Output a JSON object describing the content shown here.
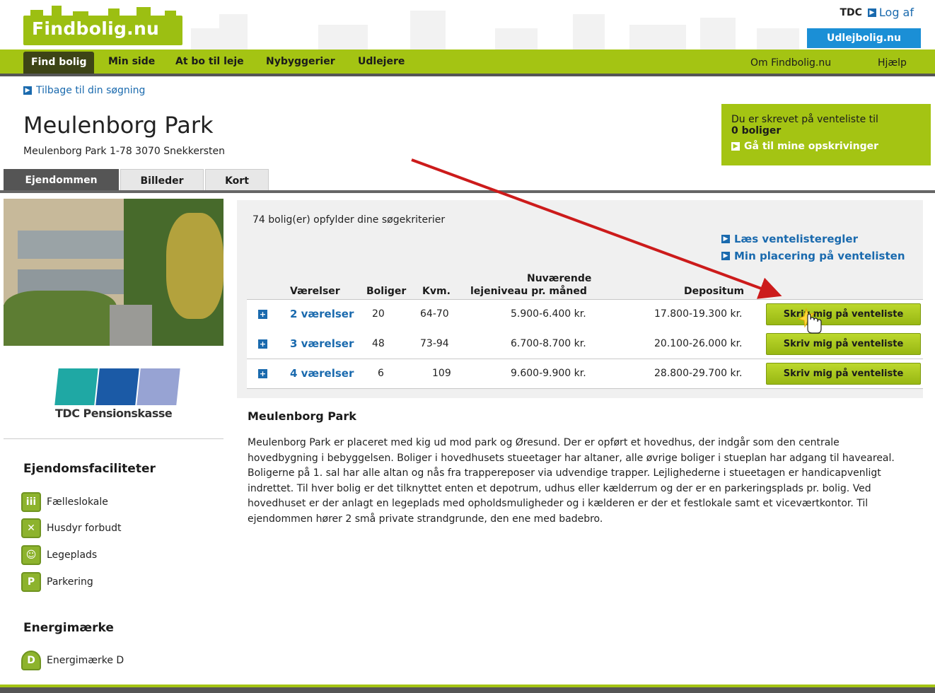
{
  "header": {
    "logo": "Findbolig.nu",
    "company": "TDC",
    "logout": "Log af",
    "partner": "Udlejbolig.nu"
  },
  "nav": {
    "items": [
      "Find bolig",
      "Min side",
      "At bo til leje",
      "Nybyggerier",
      "Udlejere"
    ],
    "right": [
      "Om Findbolig.nu",
      "Hjælp"
    ]
  },
  "back_link": "Tilbage til din søgning",
  "property": {
    "name": "Meulenborg Park",
    "address": "Meulenborg Park 1-78 3070 Snekkersten"
  },
  "waitlist": {
    "text": "Du er skrevet på venteliste til",
    "count": "0 boliger",
    "link": "Gå til mine opskrivinger"
  },
  "tabs": [
    "Ejendommen",
    "Billeder",
    "Kort"
  ],
  "sidebar": {
    "owner_logo": "TDC Pensionskasse",
    "facilities_title": "Ejendomsfaciliteter",
    "facilities": [
      {
        "label": "Fælleslokale",
        "icon": "people-icon"
      },
      {
        "label": "Husdyr forbudt",
        "icon": "no-pets-icon"
      },
      {
        "label": "Legeplads",
        "icon": "playground-icon"
      },
      {
        "label": "Parkering",
        "icon": "parking-icon"
      }
    ],
    "energy_title": "Energimærke",
    "energy_label": "Energimærke D",
    "energy_letter": "D"
  },
  "results": {
    "count_text": "74 bolig(er) opfylder dine søgekriterier",
    "links": [
      "Læs ventelisteregler",
      "Min placering på ventelisten"
    ],
    "headers": {
      "rooms": "Værelser",
      "homes": "Boliger",
      "sqm": "Kvm.",
      "rent_line1": "Nuværende",
      "rent_line2": "lejeniveau pr. måned",
      "deposit": "Depositum"
    },
    "rows": [
      {
        "rooms": "2 værelser",
        "homes": "20",
        "sqm": "64-70",
        "rent": "5.900-6.400 kr.",
        "deposit": "17.800-19.300 kr.",
        "button": "Skriv mig på venteliste"
      },
      {
        "rooms": "3 værelser",
        "homes": "48",
        "sqm": "73-94",
        "rent": "6.700-8.700 kr.",
        "deposit": "20.100-26.000 kr.",
        "button": "Skriv mig på venteliste"
      },
      {
        "rooms": "4 værelser",
        "homes": "6",
        "sqm": "109",
        "rent": "9.600-9.900 kr.",
        "deposit": "28.800-29.700 kr.",
        "button": "Skriv mig på venteliste"
      }
    ]
  },
  "description": {
    "title": "Meulenborg Park",
    "text": "Meulenborg Park er placeret med kig ud mod park og Øresund. Der er opført et hovedhus, der indgår som den centrale hovedbygning i bebyggelsen. Boliger i hovedhusets stueetager har altaner, alle øvrige boliger i stueplan har adgang til haveareal. Boligerne på 1. sal har alle altan og nås fra trappereposer via udvendige trapper. Lejlighederne i stueetagen er handicapvenligt indrettet. Til hver bolig er det tilknyttet enten et depotrum, udhus eller kælderrum og der er en parkeringsplads pr. bolig. Ved hovedhuset er der anlagt en legeplads med opholdsmuligheder og i kælderen er der et festlokale samt et viceværtkontor. Til ejendommen hører 2 små private strandgrunde, den ene med badebro."
  },
  "colors": {
    "brand_green": "#a4c413",
    "link_blue": "#1a6aae",
    "annotation_red": "#cc1b1b"
  }
}
